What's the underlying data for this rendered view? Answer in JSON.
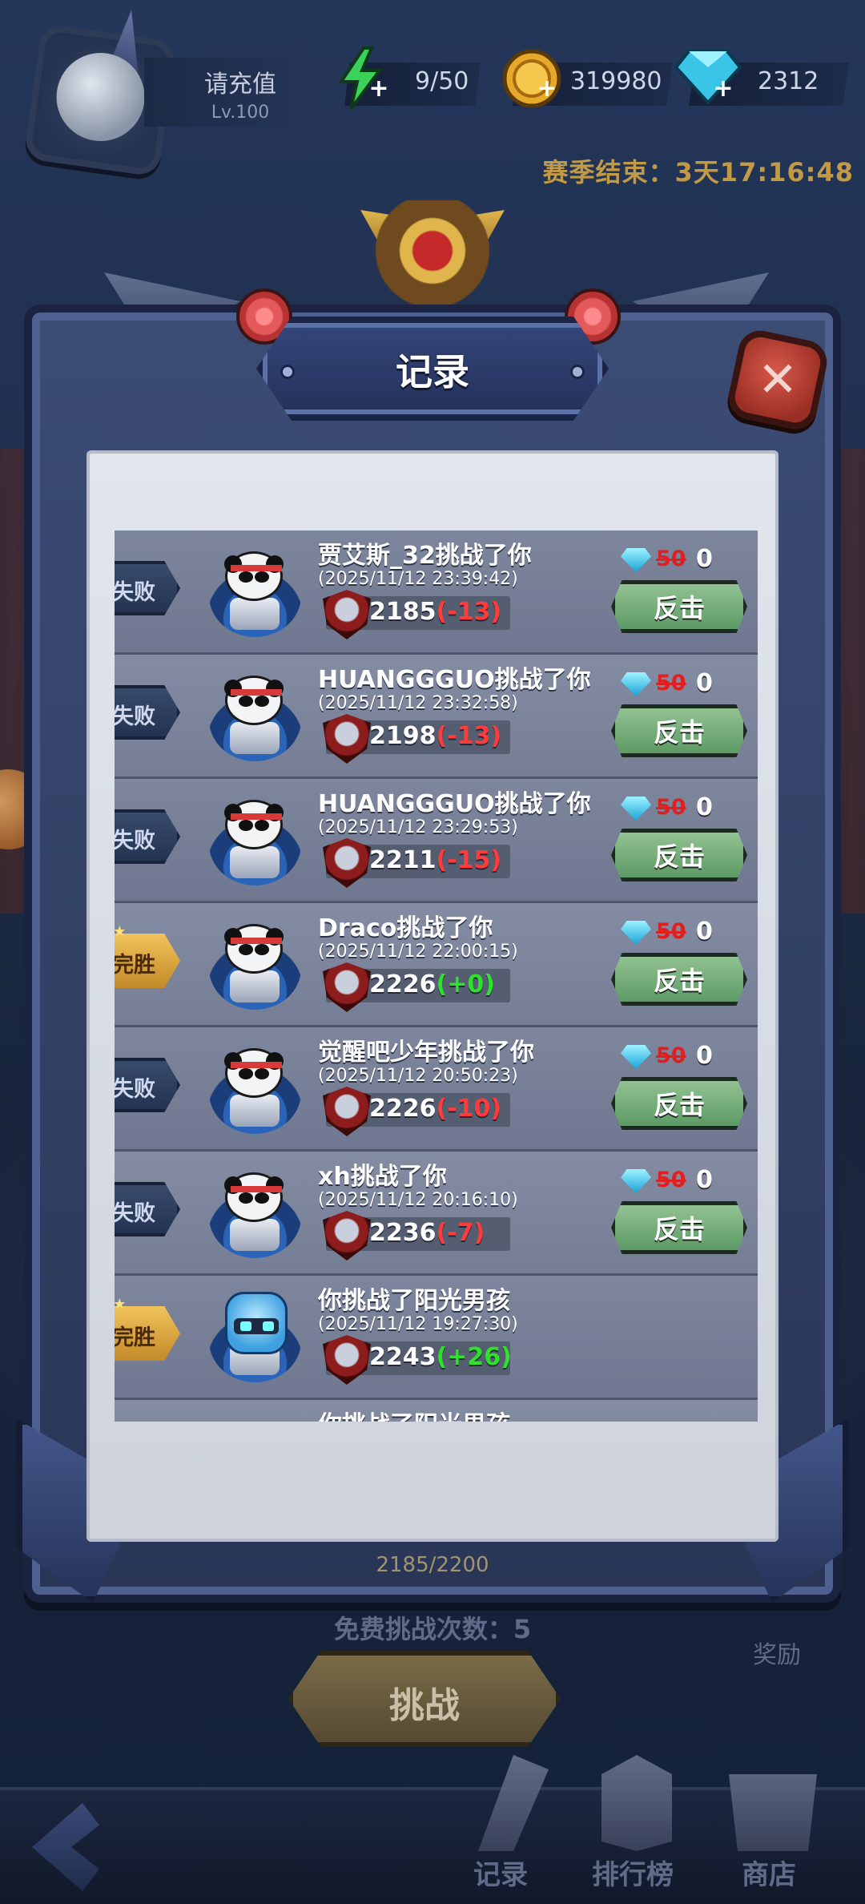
{
  "player": {
    "name": "请充值",
    "level": "Lv.100"
  },
  "resources": {
    "energy": "9/50",
    "gold": "319980",
    "gems": "2312"
  },
  "season": "赛季结束：3天17:16:48",
  "dialog": {
    "title": "记录",
    "close_icon": "close-icon"
  },
  "records": [
    {
      "result": "失败",
      "result_type": "lose",
      "avatar": "panda",
      "title": "贾艾斯_32挑战了你",
      "time": "(2025/11/12 23:39:42)",
      "score": "2185",
      "delta": "(-13)",
      "delta_sign": "neg",
      "cost_original": "50",
      "cost": "0",
      "button": "反击"
    },
    {
      "result": "失败",
      "result_type": "lose",
      "avatar": "panda",
      "title": "HUANGGGUO挑战了你",
      "time": "(2025/11/12 23:32:58)",
      "score": "2198",
      "delta": "(-13)",
      "delta_sign": "neg",
      "cost_original": "50",
      "cost": "0",
      "button": "反击"
    },
    {
      "result": "失败",
      "result_type": "lose",
      "avatar": "panda",
      "title": "HUANGGGUO挑战了你",
      "time": "(2025/11/12 23:29:53)",
      "score": "2211",
      "delta": "(-15)",
      "delta_sign": "neg",
      "cost_original": "50",
      "cost": "0",
      "button": "反击"
    },
    {
      "result": "完胜",
      "result_type": "win",
      "avatar": "panda",
      "title": "Draco挑战了你",
      "time": "(2025/11/12 22:00:15)",
      "score": "2226",
      "delta": "(+0)",
      "delta_sign": "pos",
      "cost_original": "50",
      "cost": "0",
      "button": "反击"
    },
    {
      "result": "失败",
      "result_type": "lose",
      "avatar": "panda",
      "title": "觉醒吧少年挑战了你",
      "time": "(2025/11/12 20:50:23)",
      "score": "2226",
      "delta": "(-10)",
      "delta_sign": "neg",
      "cost_original": "50",
      "cost": "0",
      "button": "反击"
    },
    {
      "result": "失败",
      "result_type": "lose",
      "avatar": "panda",
      "title": "xh挑战了你",
      "time": "(2025/11/12 20:16:10)",
      "score": "2236",
      "delta": "(-7)",
      "delta_sign": "neg",
      "cost_original": "50",
      "cost": "0",
      "button": "反击"
    },
    {
      "result": "完胜",
      "result_type": "win",
      "avatar": "robot",
      "title": "你挑战了阳光男孩",
      "time": "(2025/11/12 19:27:30)",
      "score": "2243",
      "delta": "(+26)",
      "delta_sign": "pos",
      "cost_original": "",
      "cost": "",
      "button": ""
    },
    {
      "result": "",
      "result_type": "",
      "avatar": "",
      "title": "你挑战了阳光男孩",
      "time": "",
      "score": "",
      "delta": "",
      "delta_sign": "",
      "cost_original": "",
      "cost": "",
      "button": ""
    }
  ],
  "background": {
    "rank_text": "2185/2200",
    "free_challenges": "免费挑战次数：5",
    "reward": "奖励",
    "challenge_button": "挑战"
  },
  "nav": {
    "items": [
      {
        "label": "记录",
        "icon": "record-icon"
      },
      {
        "label": "排行榜",
        "icon": "leaderboard-icon"
      },
      {
        "label": "商店",
        "icon": "shop-icon"
      }
    ]
  },
  "colors": {
    "lose_delta": "#ff3b3b",
    "win_delta": "#2de12d",
    "counter_button": "#6faa75",
    "cost_strike": "#e02020"
  }
}
